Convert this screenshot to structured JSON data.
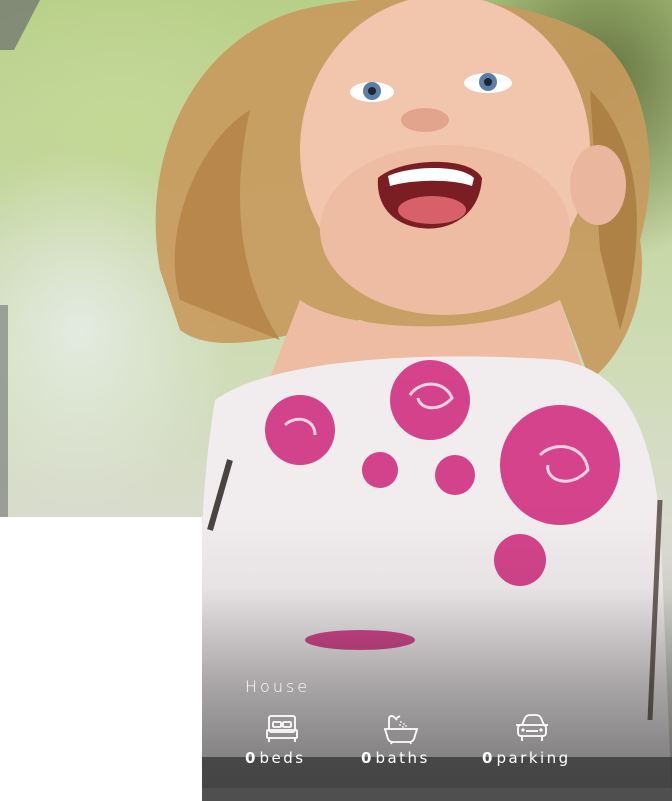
{
  "listing": {
    "property_type": "House",
    "features": [
      {
        "icon": "bed-icon",
        "count": "0",
        "unit": "beds"
      },
      {
        "icon": "bath-icon",
        "count": "0",
        "unit": "baths"
      },
      {
        "icon": "car-icon",
        "count": "0",
        "unit": "parking"
      }
    ]
  },
  "colors": {
    "overlay_text": "#ffffff",
    "strip": "#3a3a3a",
    "rose": "#d23a86"
  }
}
